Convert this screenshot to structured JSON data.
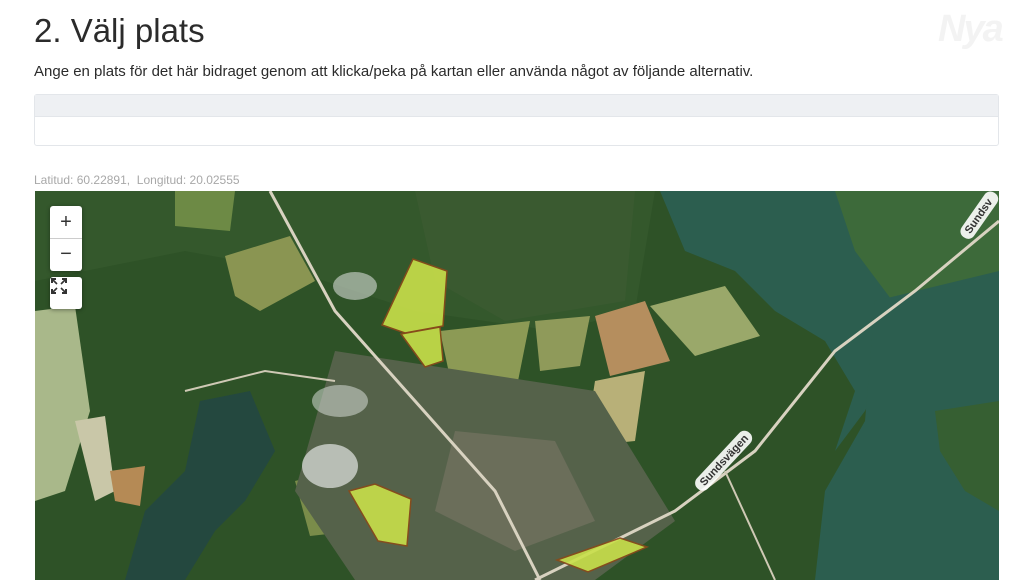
{
  "header": {
    "title": "2. Välj plats",
    "subtitle": "Ange en plats för det här bidraget genom att klicka/peka på kartan eller använda något av följande alternativ.",
    "watermark": "Nya"
  },
  "location": {
    "latitude_label": "Latitud:",
    "latitude": "60.22891",
    "longitude_label": "Longitud:",
    "longitude": "20.02555"
  },
  "map": {
    "zoom_in": "+",
    "zoom_out": "−",
    "fullscreen_icon": "fullscreen-expand-icon",
    "road_labels": [
      "Sundsvägen",
      "Sundsv"
    ],
    "colors": {
      "water": "#2c5e4f",
      "forest": "#2e5227",
      "field": "#8a9a52",
      "highlight": "#c9e04a",
      "highlight_stroke": "#8a4a1a"
    }
  }
}
